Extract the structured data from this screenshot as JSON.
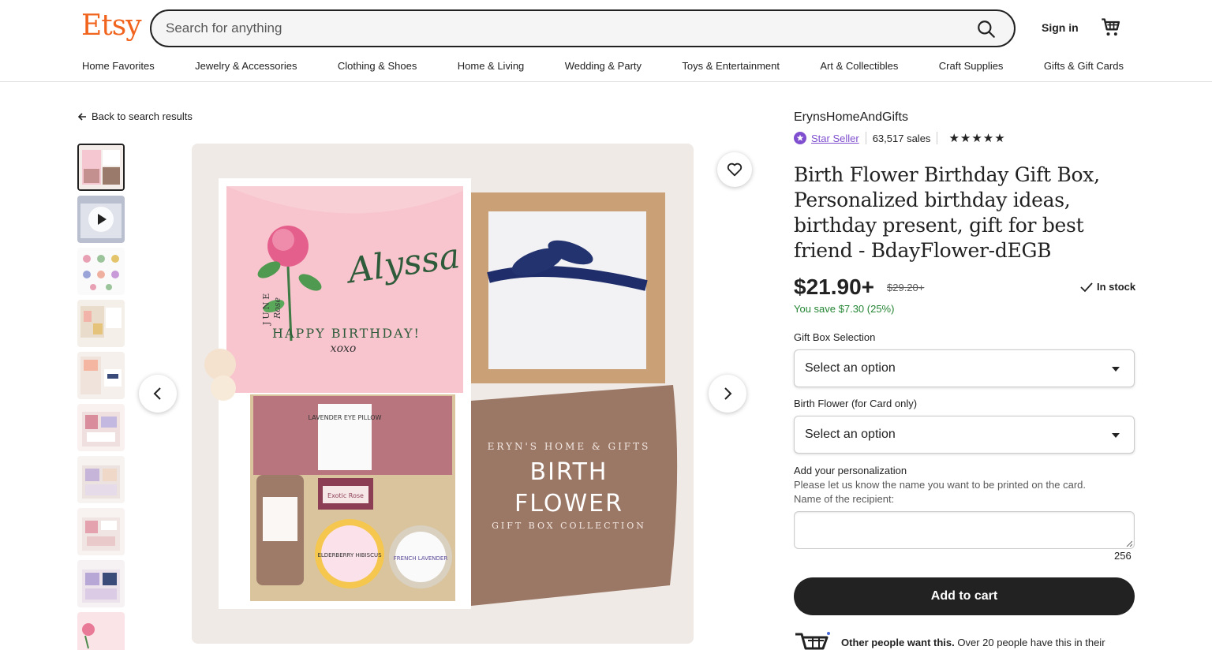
{
  "header": {
    "logo": "Etsy",
    "search_placeholder": "Search for anything",
    "signin": "Sign in"
  },
  "nav": [
    "Home Favorites",
    "Jewelry & Accessories",
    "Clothing & Shoes",
    "Home & Living",
    "Wedding & Party",
    "Toys & Entertainment",
    "Art & Collectibles",
    "Craft Supplies",
    "Gifts & Gift Cards"
  ],
  "back_link": "Back to search results",
  "product_image": {
    "name_script": "Alyssa",
    "month": "JUNE",
    "flower": "Rose",
    "card_line": "HAPPY BIRTHDAY!",
    "xoxo": "xoxo",
    "pillow_label": "LAVENDER EYE PILLOW",
    "soap_label": "Exotic Rose",
    "tin_label": "ELDERBERRY HIBISCUS",
    "candle_label": "FRENCH LAVENDER",
    "brand_line": "ERYN'S HOME & GIFTS",
    "big_line1": "BIRTH",
    "big_line2": "FLOWER",
    "collection_line": "GIFT BOX COLLECTION"
  },
  "shop": {
    "name": "ErynsHomeAndGifts",
    "star_seller": "Star Seller",
    "sales": "63,517 sales",
    "stars": "★★★★★"
  },
  "product": {
    "title": "Birth Flower Birthday Gift Box, Personalized birthday ideas, birthday present, gift for best friend - BdayFlower-dEGB",
    "price": "$21.90+",
    "old_price": "$29.20+",
    "stock": "In stock",
    "save": "You save $7.30 (25%)"
  },
  "options": {
    "gift_box_label": "Gift Box Selection",
    "gift_box_value": "Select an option",
    "flower_label": "Birth Flower (for Card only)",
    "flower_value": "Select an option",
    "personalization_label": "Add your personalization",
    "personalization_help1": "Please let us know the name you want to be printed on the card.",
    "personalization_help2": "Name of the recipient:",
    "char_count": "256"
  },
  "cart": {
    "add_label": "Add to cart",
    "demand_bold": "Other people want this.",
    "demand_text": " Over 20 people have this in their"
  },
  "colors": {
    "brand": "#f1641e",
    "star_seller": "#7f4fcf",
    "savings": "#258635",
    "button": "#222222"
  }
}
